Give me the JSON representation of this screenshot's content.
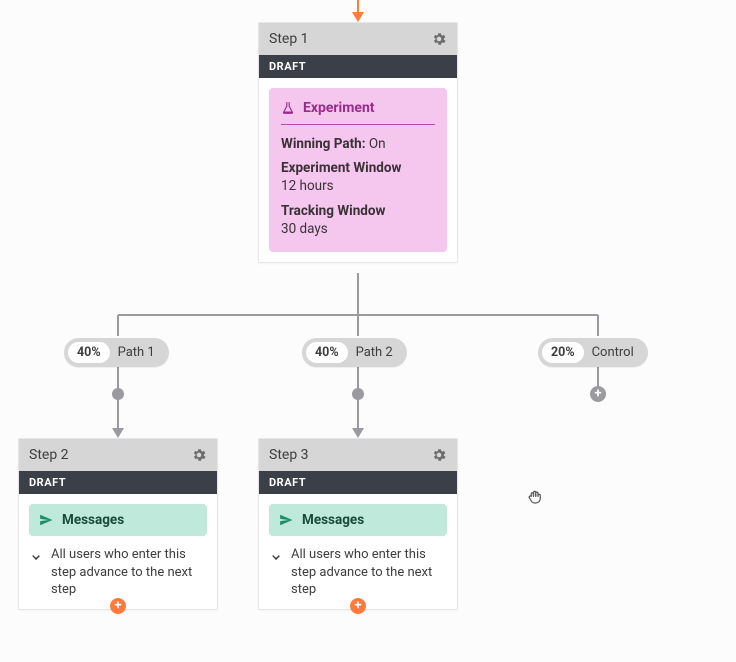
{
  "step1": {
    "title": "Step 1",
    "status": "DRAFT",
    "experiment": {
      "label": "Experiment",
      "winning_path_label": "Winning Path:",
      "winning_path_value": "On",
      "exp_window_label": "Experiment Window",
      "exp_window_value": "12 hours",
      "tracking_label": "Tracking Window",
      "tracking_value": "30 days"
    }
  },
  "paths": {
    "p1": {
      "pct": "40%",
      "label": "Path 1"
    },
    "p2": {
      "pct": "40%",
      "label": "Path 2"
    },
    "p3": {
      "pct": "20%",
      "label": "Control"
    }
  },
  "step2": {
    "title": "Step 2",
    "status": "DRAFT",
    "msg_label": "Messages",
    "advance_text": "All users who enter this step advance to the next step"
  },
  "step3": {
    "title": "Step 3",
    "status": "DRAFT",
    "msg_label": "Messages",
    "advance_text": "All users who enter this step advance to the next step"
  },
  "icons": {
    "plus": "+"
  }
}
